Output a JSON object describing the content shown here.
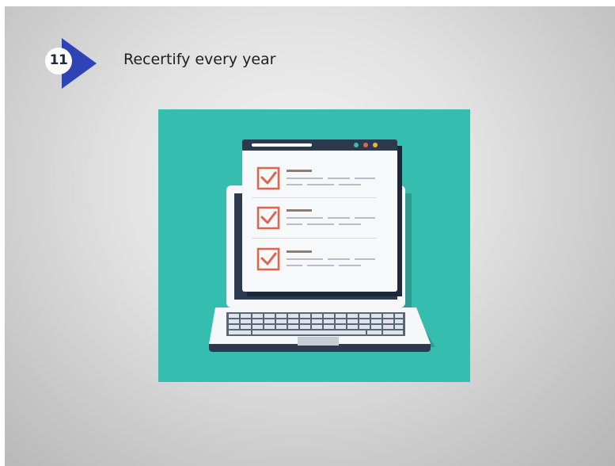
{
  "slide": {
    "step_number": "11",
    "title": "Recertify every year"
  },
  "illustration": {
    "subject": "laptop-with-checklist",
    "checklist_checked_items": 3
  },
  "colors": {
    "badge_arrow": "#2f43b6",
    "illustration_background": "#35bdb0",
    "checkbox": "#e0634c",
    "laptop_dark": "#2c3a4f"
  }
}
